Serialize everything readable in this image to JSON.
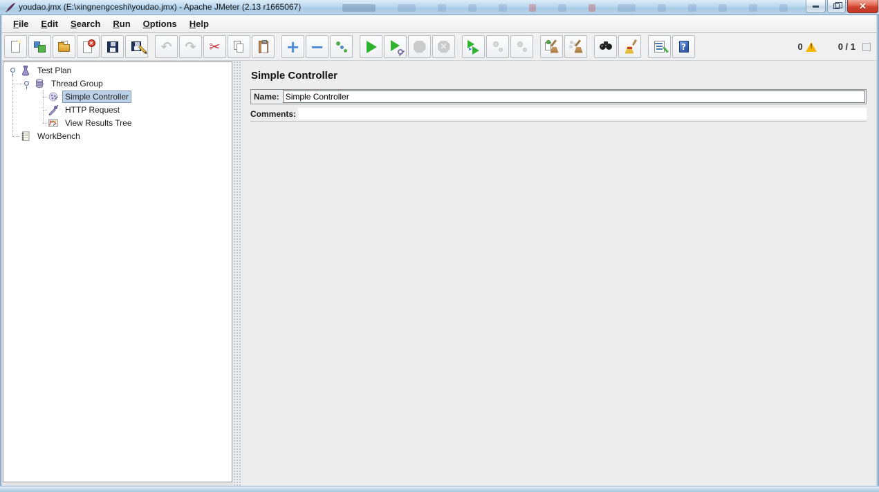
{
  "window": {
    "title": "youdao.jmx (E:\\xingnengceshi\\youdao.jmx) - Apache JMeter (2.13 r1665067)"
  },
  "menu": {
    "items": [
      "File",
      "Edit",
      "Search",
      "Run",
      "Options",
      "Help"
    ]
  },
  "icons": {
    "undo": "↶",
    "redo": "↷",
    "cut": "✂",
    "plus": "+",
    "minus": "−",
    "x": "×",
    "help_q": "?",
    "warning_mark": "!"
  },
  "toolbar": {
    "buttons": [
      {
        "name": "new",
        "enabled": true
      },
      {
        "name": "templates",
        "enabled": true
      },
      {
        "name": "open",
        "enabled": true
      },
      {
        "name": "close",
        "enabled": true
      },
      {
        "name": "save",
        "enabled": true
      },
      {
        "name": "save-as",
        "enabled": true
      },
      {
        "name": "undo",
        "enabled": false
      },
      {
        "name": "redo",
        "enabled": false
      },
      {
        "name": "cut",
        "enabled": true
      },
      {
        "name": "copy",
        "enabled": true
      },
      {
        "name": "paste",
        "enabled": true
      },
      {
        "name": "expand-all",
        "enabled": true
      },
      {
        "name": "collapse-all",
        "enabled": true
      },
      {
        "name": "toggle",
        "enabled": true
      },
      {
        "name": "start",
        "enabled": true
      },
      {
        "name": "start-no-pauses",
        "enabled": true
      },
      {
        "name": "stop",
        "enabled": false
      },
      {
        "name": "shutdown",
        "enabled": false
      },
      {
        "name": "remote-start-all",
        "enabled": true
      },
      {
        "name": "remote-stop-all",
        "enabled": false
      },
      {
        "name": "remote-shutdown-all",
        "enabled": false
      },
      {
        "name": "clear",
        "enabled": true
      },
      {
        "name": "clear-all",
        "enabled": true
      },
      {
        "name": "search",
        "enabled": true
      },
      {
        "name": "search-reset",
        "enabled": true
      },
      {
        "name": "function-helper",
        "enabled": true
      },
      {
        "name": "help",
        "enabled": true
      }
    ],
    "status": {
      "log_error_count": "0",
      "thread_count": "0 / 1"
    }
  },
  "tree": {
    "items": [
      {
        "label": "Test Plan",
        "level": 0,
        "expanded": true
      },
      {
        "label": "Thread Group",
        "level": 1,
        "expanded": true
      },
      {
        "label": "Simple Controller",
        "level": 2,
        "selected": true
      },
      {
        "label": "HTTP Request",
        "level": 2
      },
      {
        "label": "View Results Tree",
        "level": 2
      },
      {
        "label": "WorkBench",
        "level": 0
      }
    ]
  },
  "main": {
    "title": "Simple Controller",
    "name_label": "Name:",
    "name_value": "Simple Controller",
    "comments_label": "Comments:",
    "comments_value": ""
  }
}
